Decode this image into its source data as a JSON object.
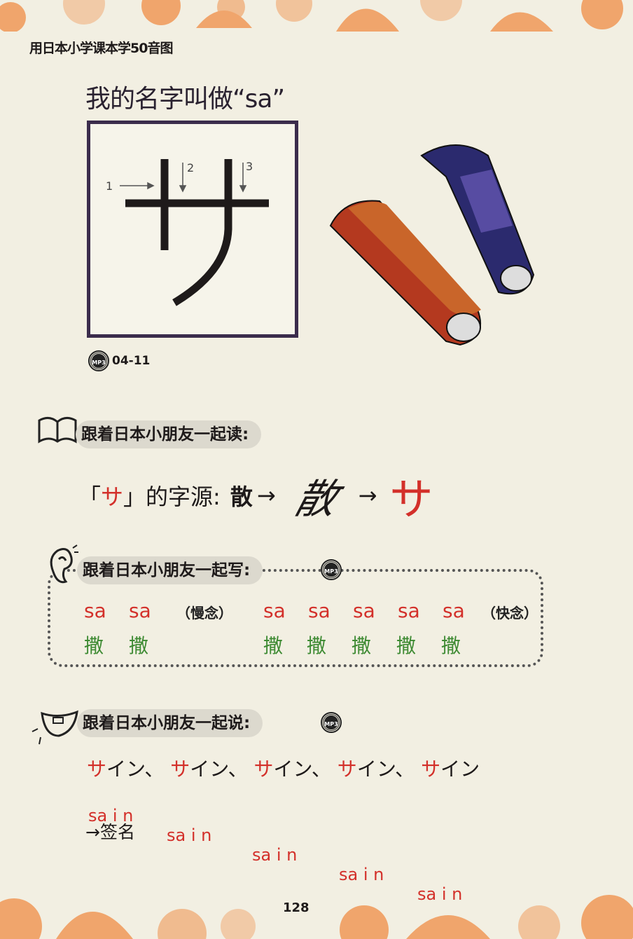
{
  "header": {
    "book_title": "用日本小学课本学50音图"
  },
  "lesson": {
    "title": "我的名字叫做“sa”",
    "kana": "サ",
    "stroke_numbers": [
      "1",
      "2",
      "3"
    ],
    "audio_track": "04-11",
    "mp3_label": "MP3"
  },
  "read_section": {
    "label": "跟着日本小朋友一起读:",
    "origin_prefix": "「",
    "origin_kana": "サ",
    "origin_suffix": "」的字源:",
    "source_char": "散",
    "arrow": "→",
    "cursive_char": "散",
    "result_kana": "サ"
  },
  "write_section": {
    "label": "跟着日本小朋友一起写:",
    "slow_romaji": [
      "sa",
      "sa"
    ],
    "slow_chars": [
      "撒",
      "撒"
    ],
    "slow_note": "（慢念）",
    "fast_romaji": [
      "sa",
      "sa",
      "sa",
      "sa",
      "sa"
    ],
    "fast_chars": [
      "撒",
      "撒",
      "撒",
      "撒",
      "撒"
    ],
    "fast_note": "（快念）"
  },
  "speak_section": {
    "label": "跟着日本小朋友一起说:",
    "words": [
      {
        "first": "サ",
        "rest": "イン"
      },
      {
        "first": "サ",
        "rest": "イン"
      },
      {
        "first": "サ",
        "rest": "イン"
      },
      {
        "first": "サ",
        "rest": "イン"
      },
      {
        "first": "サ",
        "rest": "イン"
      }
    ],
    "separator": "、",
    "romaji": [
      "sa i n",
      "sa i n",
      "sa i n",
      "sa i n",
      "sa i n"
    ],
    "meaning": "→签名"
  },
  "footer": {
    "page_number": "128"
  },
  "colors": {
    "accent_red": "#d3302a",
    "green": "#3d8a32",
    "floral": "#f0a56c",
    "box_border": "#3b2c4c"
  }
}
